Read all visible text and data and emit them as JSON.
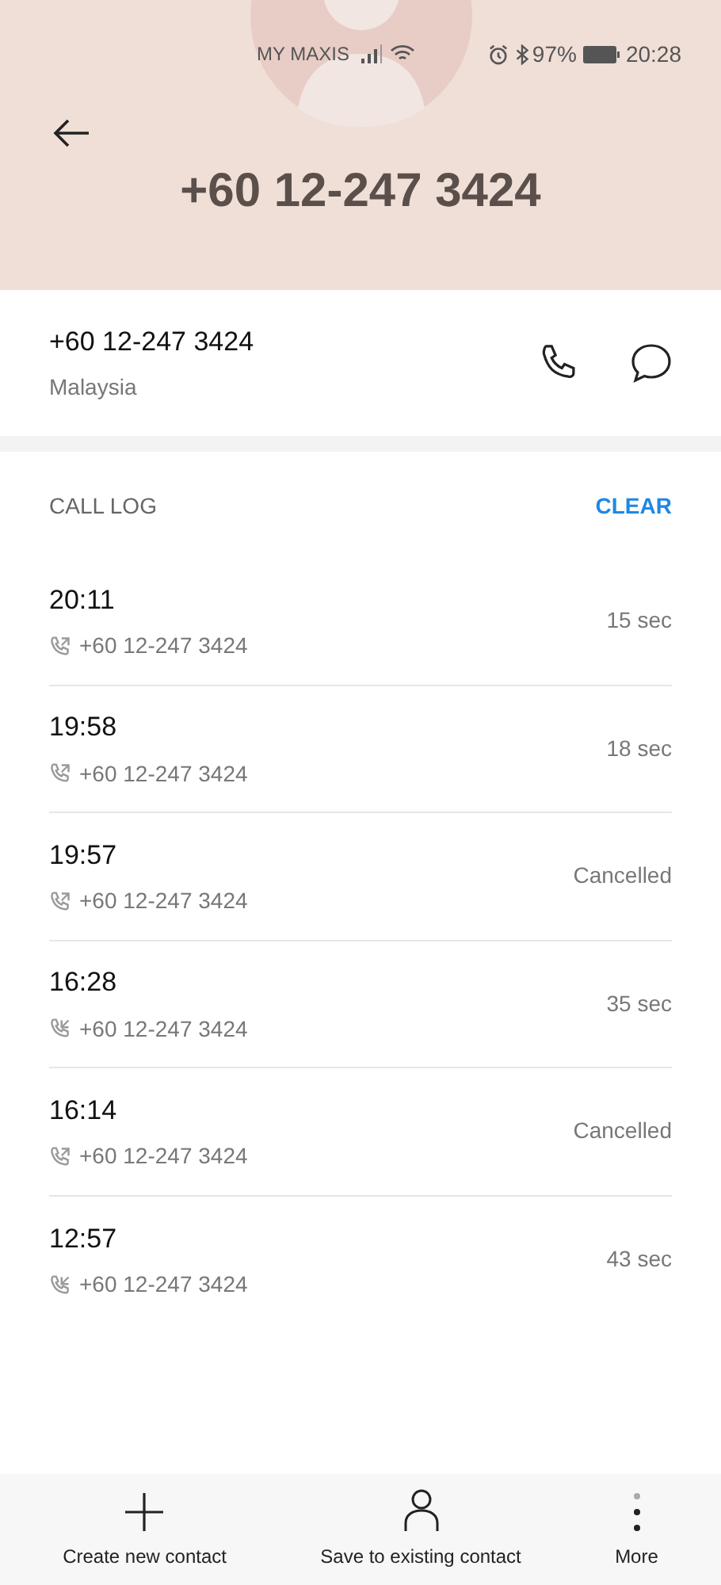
{
  "status_bar": {
    "carrier": "MY MAXIS",
    "battery": "97%",
    "time": "20:28"
  },
  "header": {
    "title": "+60 12-247 3424"
  },
  "contact": {
    "number": "+60 12-247 3424",
    "region": "Malaysia"
  },
  "call_log": {
    "title": "CALL LOG",
    "action": "CLEAR",
    "entries": [
      {
        "time": "20:11",
        "kind": "outgoing",
        "number": "+60 12-247 3424",
        "duration": "15 sec"
      },
      {
        "time": "19:58",
        "kind": "outgoing",
        "number": "+60 12-247 3424",
        "duration": "18 sec"
      },
      {
        "time": "19:57",
        "kind": "outgoing",
        "number": "+60 12-247 3424",
        "duration": "Cancelled"
      },
      {
        "time": "16:28",
        "kind": "incoming",
        "number": "+60 12-247 3424",
        "duration": "35 sec"
      },
      {
        "time": "16:14",
        "kind": "outgoing",
        "number": "+60 12-247 3424",
        "duration": "Cancelled"
      },
      {
        "time": "12:57",
        "kind": "incoming",
        "number": "+60 12-247 3424",
        "duration": "43 sec"
      }
    ]
  },
  "bottom_bar": [
    {
      "kind": "add",
      "label": "Create new contact"
    },
    {
      "kind": "person",
      "label": "Save to existing contact"
    },
    {
      "kind": "more",
      "label": "More"
    }
  ]
}
